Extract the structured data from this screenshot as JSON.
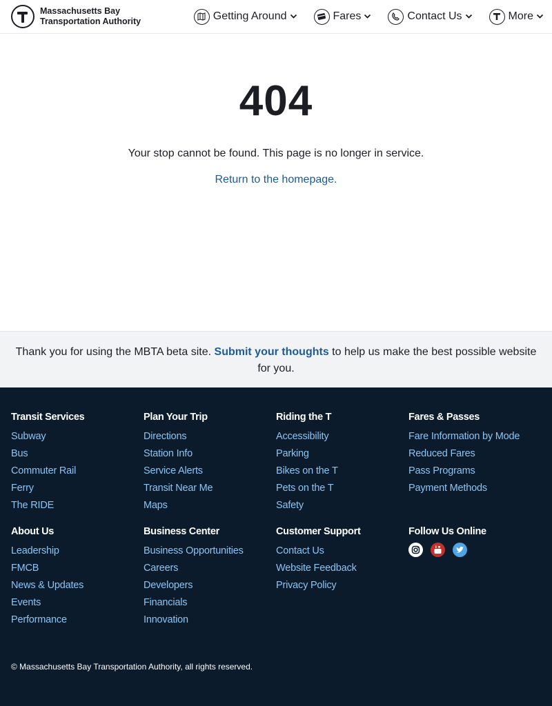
{
  "header": {
    "logo_line1": "Massachusetts Bay",
    "logo_line2": "Transportation Authority",
    "nav": [
      {
        "label": "Getting Around",
        "icon": "map-icon"
      },
      {
        "label": "Fares",
        "icon": "fare-card-icon"
      },
      {
        "label": "Contact Us",
        "icon": "phone-icon"
      },
      {
        "label": "More",
        "icon": "t-logo-icon"
      }
    ]
  },
  "main": {
    "code": "404",
    "message": "Your stop cannot be found. This page is no longer in service.",
    "home_link": "Return to the homepage."
  },
  "feedback": {
    "prefix": "Thank you for using the MBTA beta site. ",
    "link": "Submit your thoughts",
    "suffix": " to help us make the best possible website for you."
  },
  "footer": {
    "columns": [
      {
        "title": "Transit Services",
        "links": [
          "Subway",
          "Bus",
          "Commuter Rail",
          "Ferry",
          "The RIDE"
        ]
      },
      {
        "title": "Plan Your Trip",
        "links": [
          "Directions",
          "Station Info",
          "Service Alerts",
          "Transit Near Me",
          "Maps"
        ]
      },
      {
        "title": "Riding the T",
        "links": [
          "Accessibility",
          "Parking",
          "Bikes on the T",
          "Pets on the T",
          "Safety"
        ]
      },
      {
        "title": "Fares & Passes",
        "links": [
          "Fare Information by Mode",
          "Reduced Fares",
          "Pass Programs",
          "Payment Methods"
        ]
      },
      {
        "title": "About Us",
        "links": [
          "Leadership",
          "FMCB",
          "News & Updates",
          "Events",
          "Performance"
        ]
      },
      {
        "title": "Business Center",
        "links": [
          "Business Opportunities",
          "Careers",
          "Developers",
          "Financials",
          "Innovation"
        ]
      },
      {
        "title": "Customer Support",
        "links": [
          "Contact Us",
          "Website Feedback",
          "Privacy Policy"
        ]
      },
      {
        "title": "Follow Us Online",
        "links": []
      }
    ],
    "social": [
      {
        "name": "instagram-icon",
        "color": "#ffffff"
      },
      {
        "name": "youtube-icon",
        "color": "#c4302b"
      },
      {
        "name": "twitter-icon",
        "color": "#4fa3e8"
      }
    ],
    "copyright": "© Massachusetts Bay Transportation Authority, all rights reserved."
  },
  "colors": {
    "link": "#1c5b97",
    "footer_bg": "#0b1b2b",
    "footer_link": "#8cc4f3",
    "feedback_bg": "#f2f3f5"
  }
}
